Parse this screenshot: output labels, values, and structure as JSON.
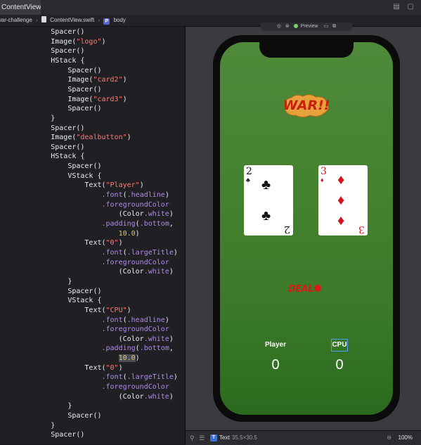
{
  "tabs": {
    "active_file": "ContentView.swift"
  },
  "breadcrumb": {
    "project": "war-challenge",
    "file": "ContentView.swift",
    "symbol": "body"
  },
  "code": [
    "            Spacer()",
    "            Image(\"logo\")",
    "            Spacer()",
    "            HStack {",
    "                Spacer()",
    "                Image(\"card2\")",
    "                Spacer()",
    "                Image(\"card3\")",
    "                Spacer()",
    "            }",
    "            Spacer()",
    "            Image(\"dealbutton\")",
    "            Spacer()",
    "            HStack {",
    "                Spacer()",
    "                VStack {",
    "                    Text(\"Player\")",
    "                        .font(.headline)",
    "                        .foregroundColor",
    "                            (Color.white)",
    "                        .padding(.bottom,",
    "                            10.0)",
    "                    Text(\"0\")",
    "                        .font(.largeTitle)",
    "                        .foregroundColor",
    "                            (Color.white)",
    "                }",
    "                Spacer()",
    "                VStack {",
    "                    Text(\"CPU\")",
    "                        .font(.headline)",
    "                        .foregroundColor",
    "                            (Color.white)",
    "                        .padding(.bottom,",
    "                            10.0)",
    "                    Text(\"0\")",
    "                        .font(.largeTitle)",
    "                        .foregroundColor",
    "                            (Color.white)",
    "                }",
    "                Spacer()",
    "            }",
    "            Spacer()"
  ],
  "preview": {
    "toolbar_label": "Preview",
    "logo_text": "WAR!!",
    "card_left": {
      "rank": "2",
      "suit": "♣"
    },
    "card_right": {
      "rank": "3",
      "suit": "♦"
    },
    "deal_text": "DEAL",
    "player_label": "Player",
    "cpu_label": "CPU",
    "player_score": "0",
    "cpu_score": "0"
  },
  "statusbar": {
    "element_type": "Text",
    "element_size": "35.5×30.5",
    "zoom": "100%"
  },
  "colors": {
    "felt_green": "#44822f",
    "card_red": "#d0131e",
    "logo_red": "#c81f12"
  }
}
